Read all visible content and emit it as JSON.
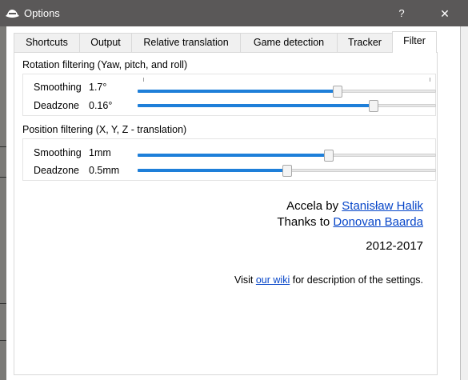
{
  "window": {
    "title": "Options",
    "help_glyph": "?",
    "close_glyph": "✕"
  },
  "tabs": [
    {
      "label": "Shortcuts",
      "active": false
    },
    {
      "label": "Output",
      "active": false
    },
    {
      "label": "Relative translation",
      "active": false
    },
    {
      "label": "Game detection",
      "active": false
    },
    {
      "label": "Tracker",
      "active": false
    },
    {
      "label": "Filter",
      "active": true
    }
  ],
  "rotation": {
    "title": "Rotation filtering (Yaw, pitch, and roll)",
    "smoothing": {
      "label": "Smoothing",
      "value": "1.7°",
      "fraction": 0.67
    },
    "deadzone": {
      "label": "Deadzone",
      "value": "0.16°",
      "fraction": 0.79
    }
  },
  "position": {
    "title": "Position filtering (X, Y, Z - translation)",
    "smoothing": {
      "label": "Smoothing",
      "value": "1mm",
      "fraction": 0.64
    },
    "deadzone": {
      "label": "Deadzone",
      "value": "0.5mm",
      "fraction": 0.5
    }
  },
  "about": {
    "accela_prefix": "Accela by",
    "author": "Stanisław Halik",
    "thanks_prefix": "Thanks to",
    "thanks_name": "Donovan Baarda",
    "years": "2012-2017",
    "visit_prefix": "Visit",
    "wiki_link": "our wiki",
    "visit_suffix": "for description of the settings."
  },
  "colors": {
    "titlebar": "#5a5858",
    "slider_fill": "#1e7fd9",
    "link": "#0645c8"
  },
  "icons": {
    "app": "fedora-hat-icon"
  }
}
